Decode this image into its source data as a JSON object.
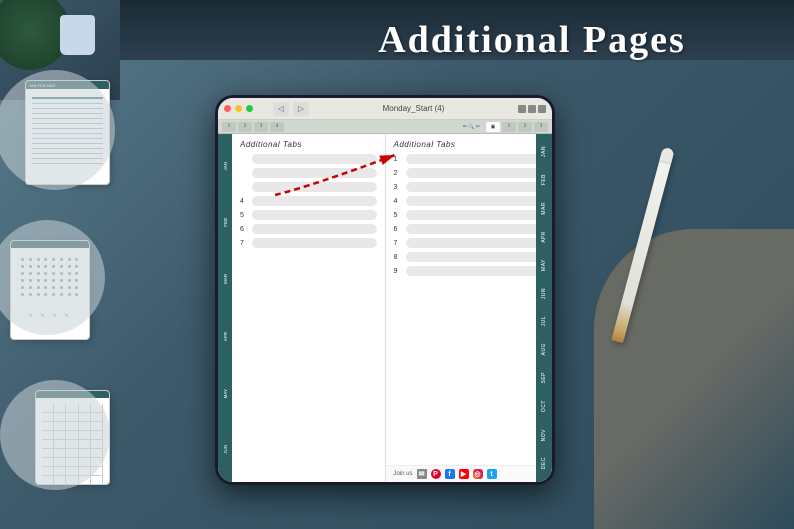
{
  "title": "Additional Pages",
  "heading": "ADDITIONAL TABS",
  "tablet": {
    "toolbar_title": "Monday_Start (4)",
    "left_page": {
      "section_title": "Additional Tabs",
      "rows": [
        {
          "number": "",
          "empty": true
        },
        {
          "number": "",
          "empty": true
        },
        {
          "number": "",
          "empty": true
        },
        {
          "number": "4",
          "empty": false
        },
        {
          "number": "5",
          "empty": false
        },
        {
          "number": "6",
          "empty": false
        },
        {
          "number": "7",
          "empty": false
        }
      ]
    },
    "right_page": {
      "section_title": "Additional Tabs",
      "rows": [
        {
          "number": "1"
        },
        {
          "number": "2"
        },
        {
          "number": "3"
        },
        {
          "number": "4"
        },
        {
          "number": "5"
        },
        {
          "number": "6"
        },
        {
          "number": "7"
        },
        {
          "number": "8"
        },
        {
          "number": "9"
        }
      ]
    },
    "months": [
      "JAN",
      "FEB",
      "MAR",
      "APR",
      "MAY",
      "JUN",
      "JUL",
      "AUG",
      "SEP",
      "OCT",
      "NOV",
      "DEC"
    ]
  },
  "join_us": {
    "label": "Join us"
  },
  "social_icons": [
    "email",
    "pinterest",
    "facebook",
    "youtube",
    "instagram",
    "twitter"
  ]
}
